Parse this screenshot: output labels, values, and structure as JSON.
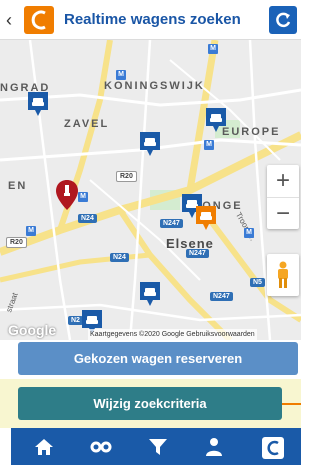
{
  "header": {
    "title": "Realtime wagens zoeken",
    "back_icon": "chevron-left-icon",
    "logo_icon": "brand-logo-icon",
    "refresh_icon": "refresh-icon",
    "brand_color": "#f07d00",
    "title_color": "#1a56a6"
  },
  "map": {
    "labels": {
      "koningswijk": "KONINGSWIJK",
      "grad": "NGRAD",
      "zavel": "ZAVEL",
      "europe": "EUROPE",
      "en": "EN",
      "matonge": "M  ONGE",
      "elsene": "Elsene",
      "troonstraat": "Troonstr.",
      "straat": "straat"
    },
    "roads": {
      "r20_a": "R20",
      "r20_b": "R20",
      "n24_a": "N24",
      "n24_b": "N24",
      "n247_a": "N247",
      "n247_b": "N247",
      "n247_c": "N247",
      "n5": "N5",
      "n2": "N2"
    },
    "metro_symbol": "M",
    "zoom_in": "+",
    "zoom_out": "−",
    "google": "Google",
    "attribution": "Kaartgegevens ©2020 Google   Gebruiksvoorwaarden"
  },
  "actions": {
    "reserve_label": "Gekozen wagen reserveren",
    "criteria_label": "Wijzig zoekcriteria"
  },
  "bottom_nav": {
    "items": [
      "home-icon",
      "wheels-icon",
      "filter-icon",
      "user-icon",
      "logo-icon"
    ],
    "color": "#1a5aa8"
  }
}
